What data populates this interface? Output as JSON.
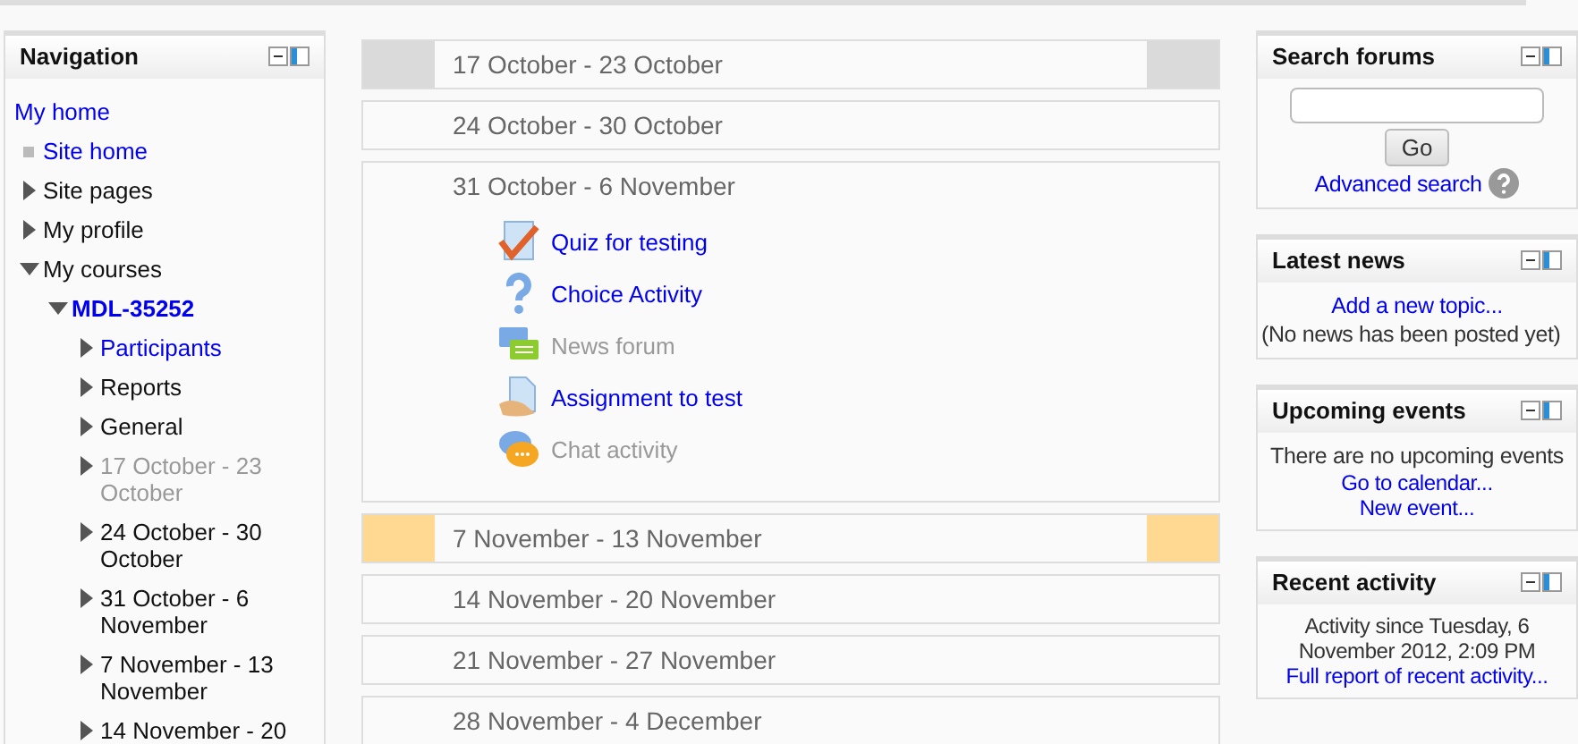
{
  "navigation": {
    "title": "Navigation",
    "home": "My home",
    "items": [
      {
        "label": "Site home",
        "kind": "link"
      },
      {
        "label": "Site pages",
        "kind": "text",
        "expanded": false
      },
      {
        "label": "My profile",
        "kind": "text",
        "expanded": false
      },
      {
        "label": "My courses",
        "kind": "text",
        "expanded": true,
        "children": [
          {
            "label": "MDL-35252",
            "kind": "course",
            "expanded": true,
            "children": [
              {
                "label": "Participants",
                "kind": "link",
                "expanded": false
              },
              {
                "label": "Reports",
                "kind": "text",
                "expanded": false
              },
              {
                "label": "General",
                "kind": "text",
                "expanded": false
              },
              {
                "label": "17 October - 23 October",
                "kind": "dimmed",
                "expanded": false
              },
              {
                "label": "24 October - 30 October",
                "kind": "text",
                "expanded": false
              },
              {
                "label": "31 October - 6 November",
                "kind": "text",
                "expanded": false
              },
              {
                "label": "7 November - 13 November",
                "kind": "text",
                "expanded": false
              },
              {
                "label": "14 November - 20",
                "kind": "text",
                "expanded": false
              }
            ]
          }
        ]
      }
    ]
  },
  "sections": [
    {
      "title": "17 October - 23 October",
      "hidden": true,
      "current": false
    },
    {
      "title": "24 October - 30 October",
      "hidden": false,
      "current": false
    },
    {
      "title": "31 October - 6 November",
      "hidden": false,
      "current": false,
      "activities": [
        {
          "label": "Quiz for testing",
          "kind": "quiz",
          "dimmed": false
        },
        {
          "label": "Choice Activity",
          "kind": "choice",
          "dimmed": false
        },
        {
          "label": "News forum",
          "kind": "forum",
          "dimmed": true
        },
        {
          "label": "Assignment to test",
          "kind": "assign",
          "dimmed": false
        },
        {
          "label": "Chat activity",
          "kind": "chat",
          "dimmed": true
        }
      ]
    },
    {
      "title": "7 November - 13 November",
      "hidden": false,
      "current": true
    },
    {
      "title": "14 November - 20 November",
      "hidden": false,
      "current": false
    },
    {
      "title": "21 November - 27 November",
      "hidden": false,
      "current": false
    },
    {
      "title": "28 November - 4 December",
      "hidden": false,
      "current": false
    }
  ],
  "blocks": [
    {
      "kind": "search",
      "title": "Search forums",
      "button": "Go",
      "link": "Advanced search"
    },
    {
      "kind": "news",
      "title": "Latest news",
      "link": "Add a new topic...",
      "note": "(No news has been posted yet)"
    },
    {
      "kind": "events",
      "title": "Upcoming events",
      "note": "There are no upcoming events",
      "links": [
        "Go to calendar...",
        "New event..."
      ]
    },
    {
      "kind": "recent",
      "title": "Recent activity",
      "note": "Activity since Tuesday, 6 November 2012, 2:09 PM",
      "link": "Full report of recent activity..."
    }
  ]
}
